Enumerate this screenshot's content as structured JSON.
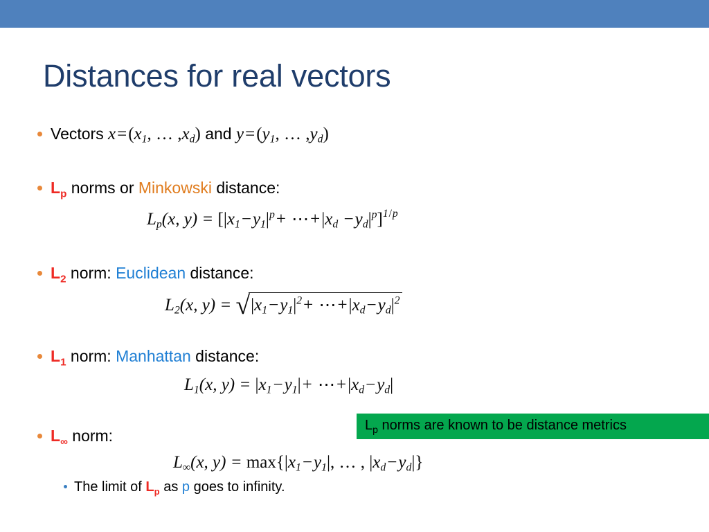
{
  "slide": {
    "title": "Distances for real vectors",
    "accent_band_color": "#4f81bd",
    "title_color": "#1f3d6b"
  },
  "colors": {
    "red": "#ee2a24",
    "orange": "#e07c1e",
    "blue": "#1f7fd4",
    "green_box": "#04a74e",
    "bullet_orange": "#e8883a",
    "bullet_blue": "#3a7fc1"
  },
  "bullets": {
    "vectors": {
      "prefix": "Vectors",
      "math": "x = (x1, …, xd) and y = (y1, …, yd)",
      "var_x": "x",
      "eq": "=",
      "open": "(",
      "x1": "x",
      "x1_sub": "1",
      "ellipsis": ", … ,",
      "xd": "x",
      "xd_sub": "d",
      "close": ")",
      "and": "and",
      "var_y": "y",
      "y1": "y",
      "y1_sub": "1",
      "yd": "y",
      "yd_sub": "d"
    },
    "lp": {
      "norm_label": "L",
      "norm_sub": "p",
      "text_a": " norms or ",
      "highlight": "Minkowski",
      "text_b": " distance:"
    },
    "l2": {
      "norm_label": "L",
      "norm_sub": "2",
      "text_a": " norm: ",
      "highlight": "Euclidean",
      "text_b": " distance:"
    },
    "l1": {
      "norm_label": "L",
      "norm_sub": "1",
      "text_a": " norm: ",
      "highlight": "Manhattan",
      "text_b": " distance:"
    },
    "linf": {
      "norm_label": "L",
      "norm_sub": "∞",
      "text_a": " norm:"
    },
    "limit": {
      "text_a": "The limit of ",
      "norm_label": "L",
      "norm_sub": "p",
      "text_b": " as ",
      "p": "p",
      "text_c": " goes to infinity."
    }
  },
  "formulas": {
    "lp": {
      "lhs_L": "L",
      "lhs_sub": "p",
      "args": "(x, y) =",
      "open_bracket": "[|",
      "x1": "x",
      "x1_sub": "1",
      "minus": "−",
      "y1": "y",
      "y1_sub": "1",
      "abs": "|",
      "exp_p": "p",
      "plus": "+",
      "cdots": "⋯",
      "plus2": "+",
      "xd": "x",
      "xd_sub": "d",
      "yd": "y",
      "yd_sub": "d",
      "close_bracket": "]",
      "exp_num": "1",
      "exp_slash": "/",
      "exp_den": "p",
      "plain": "Lp(x, y) = [|x1 − y1|^p + ⋯ + |xd − yd|^p]^(1/p)"
    },
    "l2": {
      "lhs_L": "L",
      "lhs_sub": "2",
      "args": "(x, y) =",
      "radical": "√",
      "x1": "x",
      "x1_sub": "1",
      "minus": "−",
      "y1": "y",
      "y1_sub": "1",
      "exp": "2",
      "plus": "+",
      "cdots": "⋯",
      "xd": "x",
      "xd_sub": "d",
      "yd": "y",
      "yd_sub": "d",
      "plain": "L2(x, y) = √(|x1 − y1|² + ⋯ + |xd − yd|²)"
    },
    "l1": {
      "lhs_L": "L",
      "lhs_sub": "1",
      "args": "(x, y) =",
      "x1": "x",
      "x1_sub": "1",
      "minus": "−",
      "y1": "y",
      "y1_sub": "1",
      "plus": "+",
      "cdots": "⋯",
      "xd": "x",
      "xd_sub": "d",
      "yd": "y",
      "yd_sub": "d",
      "plain": "L1(x, y) = |x1 − y1| + ⋯ + |xd − yd|"
    },
    "linf": {
      "lhs_L": "L",
      "lhs_sub": "∞",
      "args": "(x, y) =",
      "max": "max{|",
      "x1": "x",
      "x1_sub": "1",
      "minus": "−",
      "y1": "y",
      "y1_sub": "1",
      "sep": "|, … , |",
      "xd": "x",
      "xd_sub": "d",
      "yd": "y",
      "yd_sub": "d",
      "close": "|}",
      "plain": "L∞(x, y) = max{|x1 − y1|, … , |xd − yd|}"
    }
  },
  "callout": {
    "label_L": "L",
    "label_sub": "p",
    "text": " norms are known to be distance metrics",
    "full_text": "Lp norms are known to be distance metrics"
  }
}
